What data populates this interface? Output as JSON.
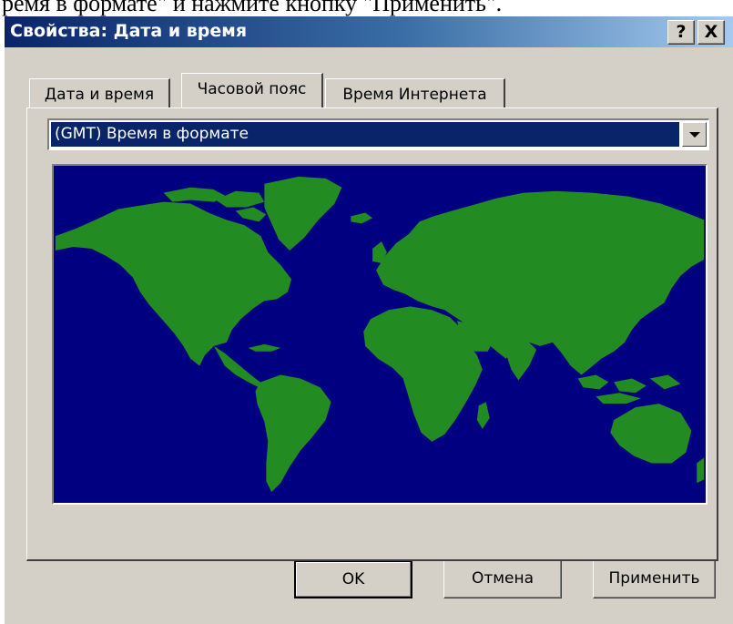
{
  "caption_fragment": "ремя в формате\" и нажмите кнопку \"Применить\".",
  "window": {
    "title": "Свойства: Дата и время",
    "help_button": "?",
    "close_button": "X"
  },
  "tabs": [
    {
      "label": "Дата и время",
      "active": false
    },
    {
      "label": "Часовой пояс",
      "active": true
    },
    {
      "label": "Время Интернета",
      "active": false
    }
  ],
  "timezone_select": {
    "value": "(GMT) Время в формате"
  },
  "map": {
    "ocean_color": "#000080",
    "land_color": "#228b22"
  },
  "buttons": {
    "ok": "OK",
    "cancel": "Отмена",
    "apply": "Применить"
  }
}
